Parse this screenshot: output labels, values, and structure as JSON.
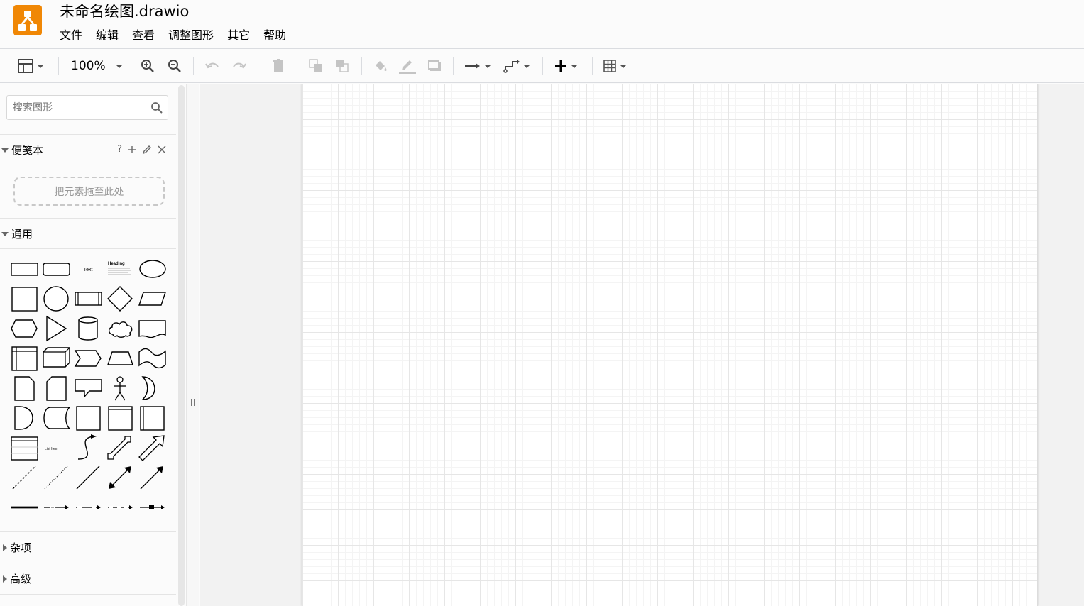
{
  "app": {
    "title": "未命名绘图.drawio",
    "logo": "drawio-logo-icon",
    "accent_color": "#f08705"
  },
  "menu": [
    "文件",
    "编辑",
    "查看",
    "调整图形",
    "其它",
    "帮助"
  ],
  "toolbar": {
    "zoom": "100%",
    "buttons": [
      {
        "name": "format-panel-toggle",
        "icon": "panel-layout-icon",
        "enabled": true
      },
      {
        "name": "zoom-in",
        "icon": "zoom-in-icon",
        "enabled": true
      },
      {
        "name": "zoom-out",
        "icon": "zoom-out-icon",
        "enabled": true
      },
      {
        "name": "undo",
        "icon": "undo-icon",
        "enabled": false
      },
      {
        "name": "redo",
        "icon": "redo-icon",
        "enabled": false
      },
      {
        "name": "delete",
        "icon": "trash-icon",
        "enabled": false
      },
      {
        "name": "to-front",
        "icon": "to-front-icon",
        "enabled": false
      },
      {
        "name": "to-back",
        "icon": "to-back-icon",
        "enabled": false
      },
      {
        "name": "fill-color",
        "icon": "fill-bucket-icon",
        "enabled": false
      },
      {
        "name": "line-color",
        "icon": "pencil-line-icon",
        "enabled": false
      },
      {
        "name": "shadow",
        "icon": "shadow-icon",
        "enabled": false
      },
      {
        "name": "connection",
        "icon": "arrow-right-icon",
        "enabled": true
      },
      {
        "name": "waypoints",
        "icon": "waypoints-icon",
        "enabled": true
      },
      {
        "name": "insert",
        "icon": "plus-icon",
        "enabled": true
      },
      {
        "name": "table",
        "icon": "table-icon",
        "enabled": true
      }
    ]
  },
  "sidebar": {
    "search_placeholder": "搜索图形",
    "scratchpad": {
      "title": "便笺本",
      "help": "?",
      "dropzone_text": "把元素拖至此处"
    },
    "sections": [
      {
        "title": "通用",
        "expanded": true
      },
      {
        "title": "杂项",
        "expanded": false
      },
      {
        "title": "高级",
        "expanded": false
      }
    ],
    "general_shapes": [
      "rectangle",
      "rounded-rectangle",
      "text",
      "textbox",
      "ellipse",
      "square",
      "circle",
      "process",
      "diamond",
      "parallelogram",
      "hexagon",
      "triangle",
      "cylinder",
      "cloud",
      "document",
      "internal-storage",
      "cube",
      "step",
      "trapezoid",
      "tape",
      "note",
      "card",
      "callout",
      "actor",
      "or",
      "and",
      "data-storage",
      "rectangle-2",
      "container",
      "container-vertical",
      "list",
      "list-item",
      "curve",
      "bidirectional-arrow",
      "arrow",
      "dashed-line",
      "dotted-line",
      "line",
      "bidirectional-connector",
      "directional-connector",
      "link",
      "connector-label",
      "connector-2-labels",
      "connector-3-labels",
      "connector-symbol"
    ],
    "shape_text": {
      "text": "Text",
      "heading": "Heading",
      "list_item": "List Item"
    }
  }
}
